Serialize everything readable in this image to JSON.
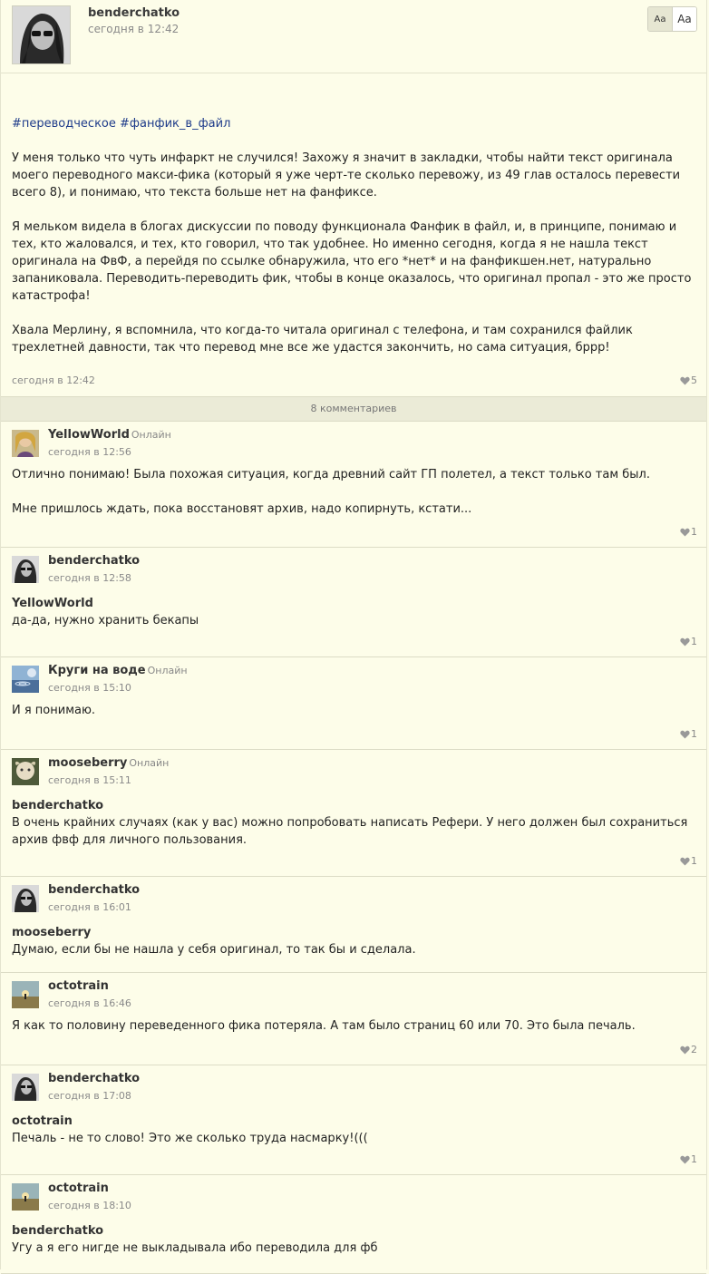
{
  "post": {
    "author": "benderchatko",
    "date": "сегодня в 12:42",
    "font_small": "Aa",
    "font_large": "Aa",
    "tags": [
      "#переводческое",
      "#фанфик_в_файл"
    ],
    "paragraphs": [
      "У меня только что чуть инфаркт не случился! Захожу я значит в закладки, чтобы найти текст оригинала моего переводного макси-фика (который я уже черт-те сколько перевожу, из 49 глав осталось перевести всего 8), и понимаю, что текста больше нет на фанфиксе.",
      "Я мельком видела в блогах дискуссии по поводу функционала Фанфик в файл, и, в принципе, понимаю и тех, кто жаловался, и тех, кто говорил, что так удобнее. Но именно сегодня, когда я не нашла текст оригинала на ФвФ, а перейдя по ссылке обнаружила, что его *нет* и на фанфикшен.нет, натурально запаниковала. Переводить-переводить фик, чтобы в конце оказалось, что оригинал пропал - это же просто катастрофа!",
      "Хвала Мерлину, я вспомнила, что когда-то читала оригинал с телефона, и там сохранился файлик трехлетней давности, так что перевод мне все же удастся закончить, но сама ситуация, бррр!"
    ],
    "footer_date": "сегодня в 12:42",
    "likes": "5"
  },
  "comments_count_label": "8 комментариев",
  "comments": [
    {
      "author": "YellowWorld",
      "online": "Онлайн",
      "date": "сегодня в 12:56",
      "reply_to": "",
      "paragraphs": [
        "Отлично понимаю! Была похожая ситуация, когда древний сайт ГП полетел, а текст только там был.",
        "Мне пришлось ждать, пока восстановят архив, надо копирнуть, кстати..."
      ],
      "likes": "1",
      "avatar": "yellow"
    },
    {
      "author": "benderchatko",
      "online": "",
      "date": "сегодня в 12:58",
      "reply_to": "YellowWorld",
      "paragraphs": [
        "да-да, нужно хранить бекапы"
      ],
      "likes": "1",
      "avatar": "bender"
    },
    {
      "author": "Круги на воде",
      "online": "Онлайн",
      "date": "сегодня в 15:10",
      "reply_to": "",
      "paragraphs": [
        "И я понимаю."
      ],
      "likes": "1",
      "avatar": "circles"
    },
    {
      "author": "mooseberry",
      "online": "Онлайн",
      "date": "сегодня в 15:11",
      "reply_to": "benderchatko",
      "paragraphs": [
        "В очень крайних случаях (как у вас) можно попробовать написать Рефери. У него должен был сохраниться архив фвф для личного пользования."
      ],
      "likes": "1",
      "avatar": "moose"
    },
    {
      "author": "benderchatko",
      "online": "",
      "date": "сегодня в 16:01",
      "reply_to": "mooseberry",
      "paragraphs": [
        "Думаю, если бы не нашла у себя оригинал, то так бы и сделала."
      ],
      "likes": "",
      "avatar": "bender"
    },
    {
      "author": "octotrain",
      "online": "",
      "date": "сегодня в 16:46",
      "reply_to": "",
      "paragraphs": [
        "Я как то половину переведенного фика потеряла. А там было страниц 60 или 70. Это была печаль."
      ],
      "likes": "2",
      "avatar": "octo"
    },
    {
      "author": "benderchatko",
      "online": "",
      "date": "сегодня в 17:08",
      "reply_to": "octotrain",
      "paragraphs": [
        "Печаль - не то слово! Это же сколько труда насмарку!((("
      ],
      "likes": "1",
      "avatar": "bender"
    },
    {
      "author": "octotrain",
      "online": "",
      "date": "сегодня в 18:10",
      "reply_to": "benderchatko",
      "paragraphs": [
        "Угу а я его нигде не выкладывала ибо переводила для фб"
      ],
      "likes": "",
      "avatar": "octo"
    }
  ]
}
